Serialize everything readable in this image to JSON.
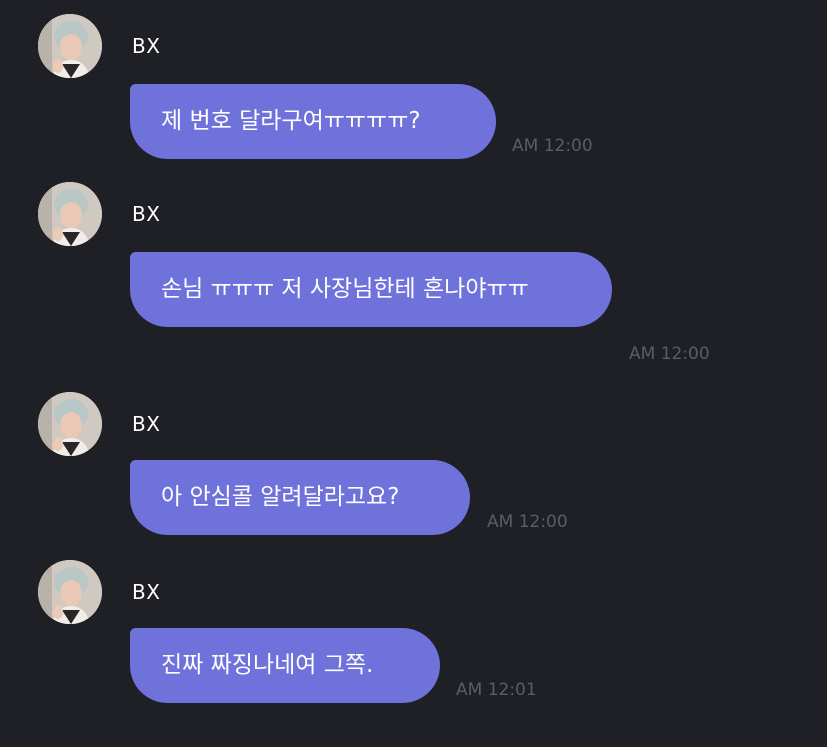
{
  "conversation": {
    "messages": [
      {
        "sender": "BX",
        "text": "제 번호 달라구여ㅠㅠㅠㅠ?",
        "time": "AM 12:00"
      },
      {
        "sender": "BX",
        "text": "손님 ㅠㅠㅠ 저 사장님한테 혼나야ㅠㅠ",
        "time": "AM 12:00"
      },
      {
        "sender": "BX",
        "text": "아 안심콜 알려달라고요?",
        "time": "AM 12:00"
      },
      {
        "sender": "BX",
        "text": "진짜 짜징나네여 그쪽.",
        "time": "AM 12:01"
      }
    ]
  },
  "colors": {
    "background": "#1f1f26",
    "bubble": "#6f72db",
    "timestamp": "#5b5c66",
    "sender_name": "#ffffff"
  },
  "icons": {
    "avatar": "profile-photo"
  }
}
